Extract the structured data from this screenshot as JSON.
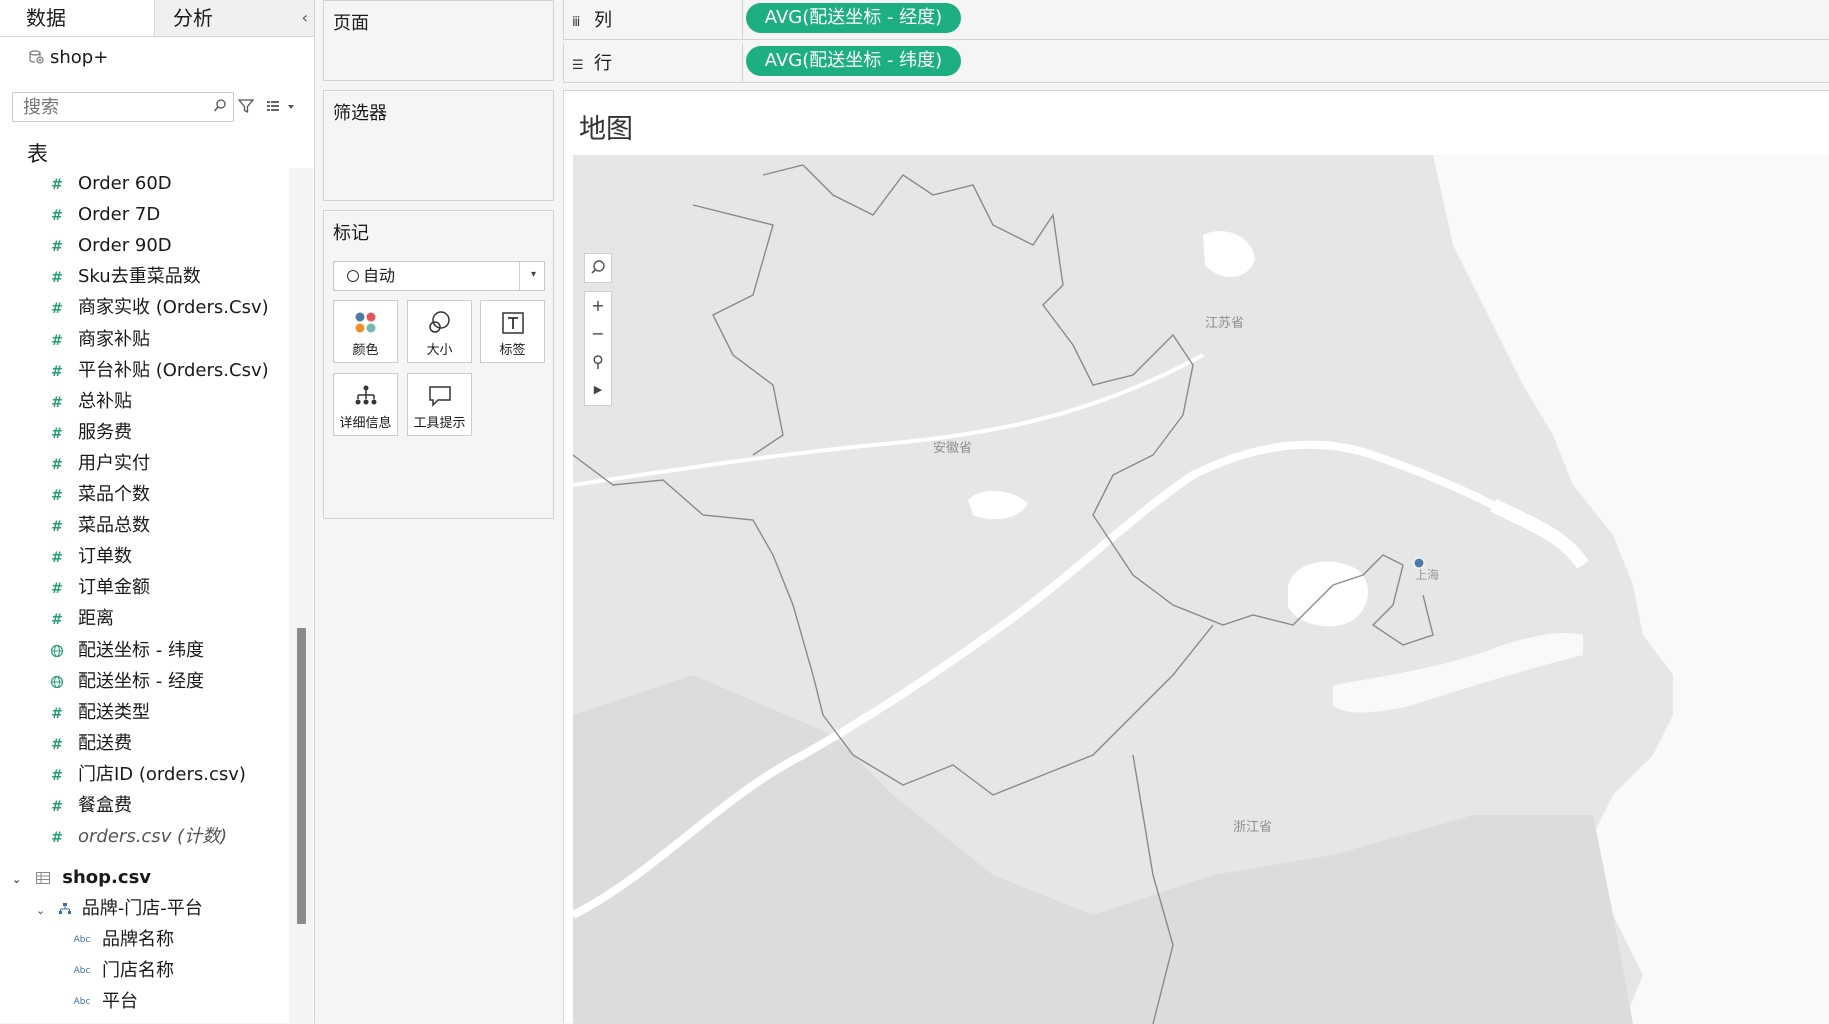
{
  "left_pane": {
    "tabs": [
      "数据",
      "分析"
    ],
    "collapse_glyph": "‹",
    "datasource": "shop+",
    "search_placeholder": "搜索",
    "tables_title": "表",
    "fields": [
      {
        "label": "Order 60D",
        "type": "measure"
      },
      {
        "label": "Order 7D",
        "type": "measure"
      },
      {
        "label": "Order 90D",
        "type": "measure"
      },
      {
        "label": "Sku去重菜品数",
        "type": "measure"
      },
      {
        "label": "商家实收 (Orders.Csv)",
        "type": "measure"
      },
      {
        "label": "商家补贴",
        "type": "measure"
      },
      {
        "label": "平台补贴 (Orders.Csv)",
        "type": "measure"
      },
      {
        "label": "总补贴",
        "type": "measure"
      },
      {
        "label": "服务费",
        "type": "measure"
      },
      {
        "label": "用户实付",
        "type": "measure"
      },
      {
        "label": "菜品个数",
        "type": "measure"
      },
      {
        "label": "菜品总数",
        "type": "measure"
      },
      {
        "label": "订单数",
        "type": "measure"
      },
      {
        "label": "订单金额",
        "type": "measure"
      },
      {
        "label": "距离",
        "type": "measure"
      },
      {
        "label": "配送坐标 - 纬度",
        "type": "geo"
      },
      {
        "label": "配送坐标 - 经度",
        "type": "geo"
      },
      {
        "label": "配送类型",
        "type": "measure"
      },
      {
        "label": "配送费",
        "type": "measure"
      },
      {
        "label": "门店ID (orders.csv)",
        "type": "measure"
      },
      {
        "label": "餐盒费",
        "type": "measure"
      },
      {
        "label": "orders.csv (计数)",
        "type": "count"
      }
    ],
    "shop_table": {
      "name": "shop.csv",
      "hierarchy": "品牌-门店-平台",
      "children": [
        "品牌名称",
        "门店名称",
        "平台"
      ],
      "abc_label": "Abc"
    }
  },
  "cards": {
    "pages": "页面",
    "filters": "筛选器",
    "marks": "标记",
    "mark_type": "自动",
    "mark_buttons": [
      "颜色",
      "大小",
      "标签",
      "详细信息",
      "工具提示"
    ]
  },
  "shelves": {
    "columns": {
      "label": "列",
      "pill": "AVG(配送坐标 - 经度)"
    },
    "rows": {
      "label": "行",
      "pill": "AVG(配送坐标 - 纬度)"
    }
  },
  "view": {
    "title": "地图",
    "map_labels": {
      "jiangsu": "江苏省",
      "anhui": "安徽省",
      "zhejiang": "浙江省",
      "shanghai": "上海"
    },
    "point_color": "#4e79a7"
  },
  "colors": {
    "pill": "#1dae82",
    "measure_icon": "#2a9d77"
  }
}
